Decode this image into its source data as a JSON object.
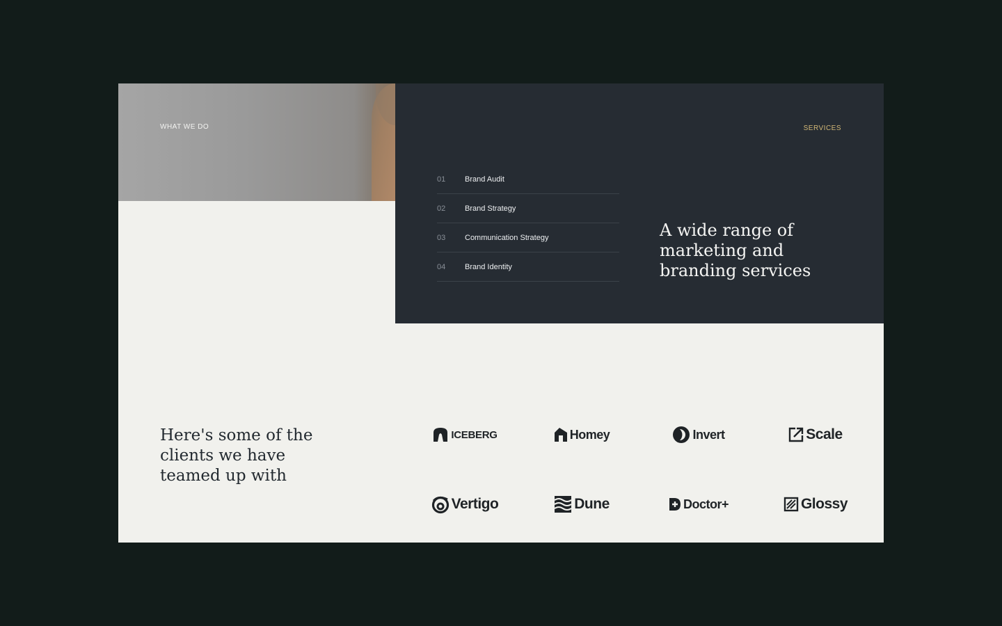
{
  "what_we_do": {
    "label": "WHAT WE DO"
  },
  "services": {
    "label": "SERVICES",
    "headline": "A wide range of marketing and branding services",
    "items": [
      {
        "num": "01",
        "label": "Brand Audit"
      },
      {
        "num": "02",
        "label": "Brand Strategy"
      },
      {
        "num": "03",
        "label": "Communication Strategy"
      },
      {
        "num": "04",
        "label": "Brand Identity"
      }
    ]
  },
  "clients": {
    "headline": "Here's some of the clients we have teamed up with",
    "logos": [
      {
        "name": "ICEBERG",
        "icon": "iceberg-icon"
      },
      {
        "name": "Homey",
        "icon": "homey-icon"
      },
      {
        "name": "Invert",
        "icon": "invert-icon"
      },
      {
        "name": "Scale",
        "icon": "scale-icon"
      },
      {
        "name": "Vertigo",
        "icon": "vertigo-icon"
      },
      {
        "name": "Dune",
        "icon": "dune-icon"
      },
      {
        "name": "Doctor+",
        "icon": "doctor-plus-icon"
      },
      {
        "name": "Glossy",
        "icon": "glossy-icon"
      }
    ]
  },
  "colors": {
    "page_bg": "#121c1a",
    "card_bg": "#f1f1ed",
    "services_panel": "#262c33",
    "accent_gold": "#d4b977",
    "text_dark": "#232a30"
  }
}
